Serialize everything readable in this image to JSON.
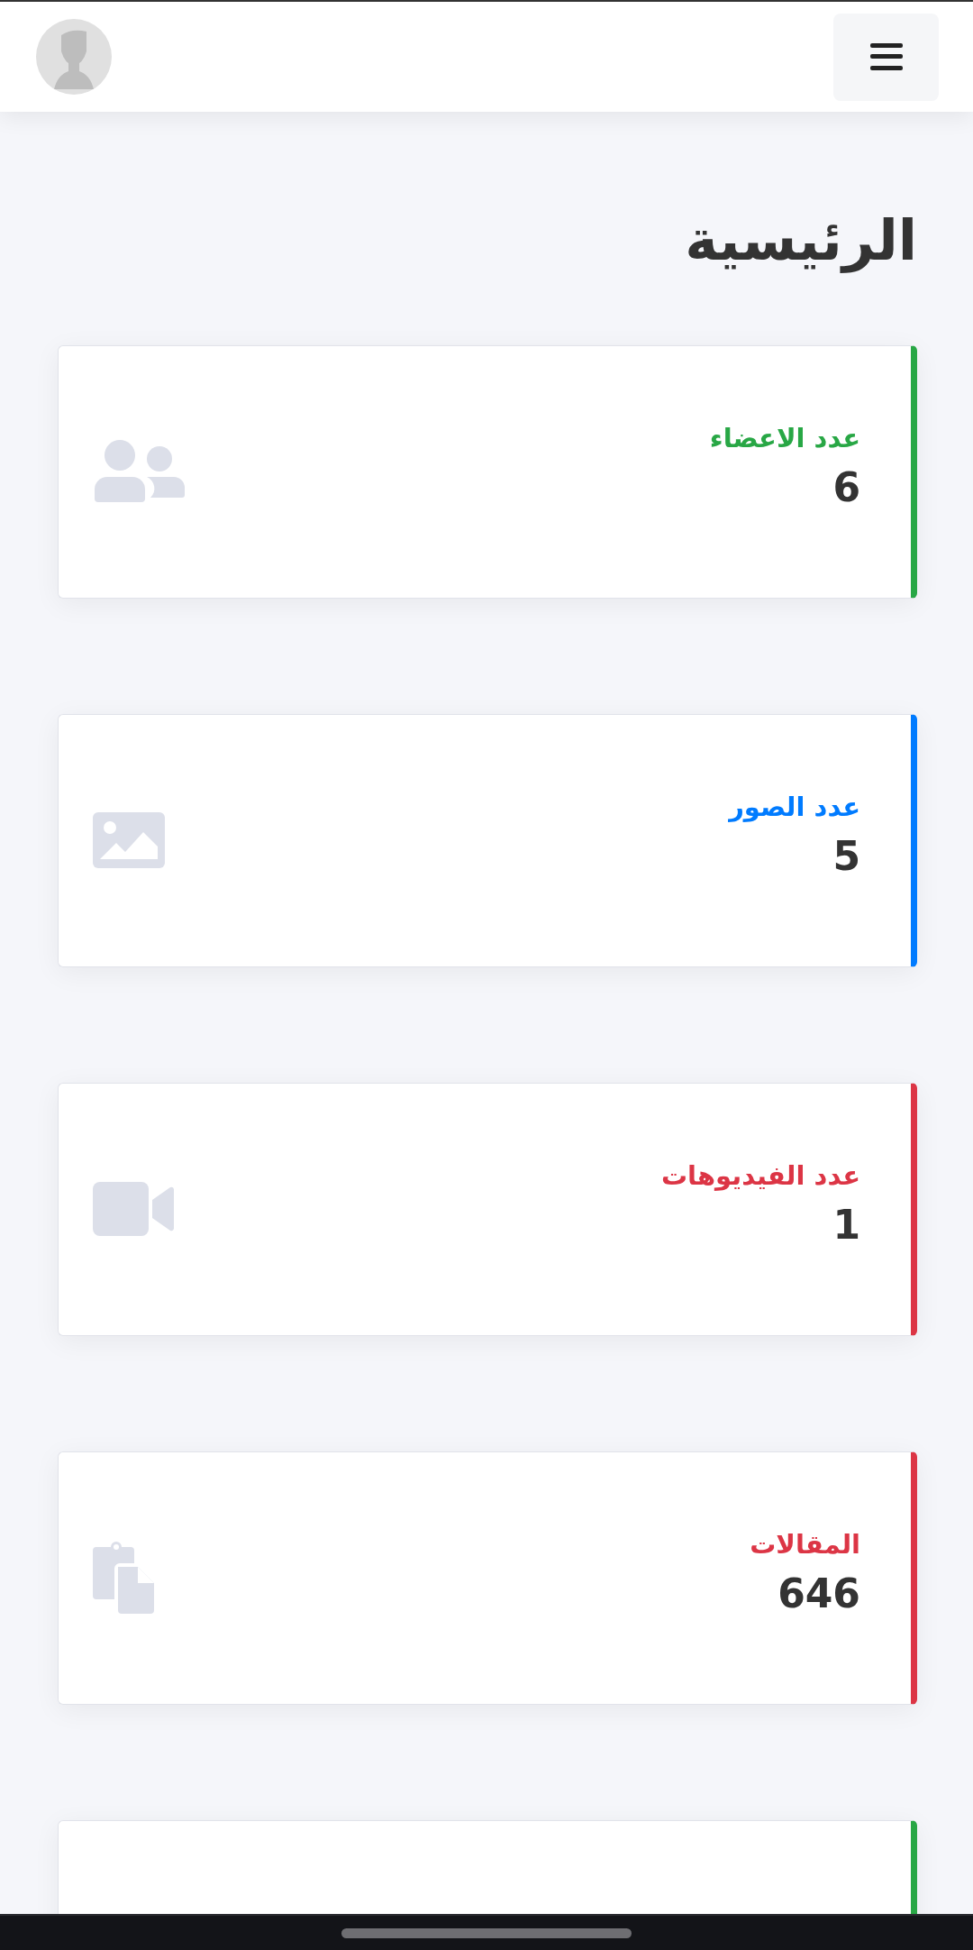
{
  "page_title": "الرئيسية",
  "stats": [
    {
      "label": "عدد الاعضاء",
      "value": "6",
      "color": "#28a745",
      "kind": "members"
    },
    {
      "label": "عدد الصور",
      "value": "5",
      "color": "#007bff",
      "kind": "images"
    },
    {
      "label": "عدد الفيديوهات",
      "value": "1",
      "color": "#dc3545",
      "kind": "videos"
    },
    {
      "label": "المقالات",
      "value": "646",
      "color": "#dc3545",
      "kind": "articles"
    },
    {
      "color": "#28a745",
      "kind": "cut"
    }
  ]
}
